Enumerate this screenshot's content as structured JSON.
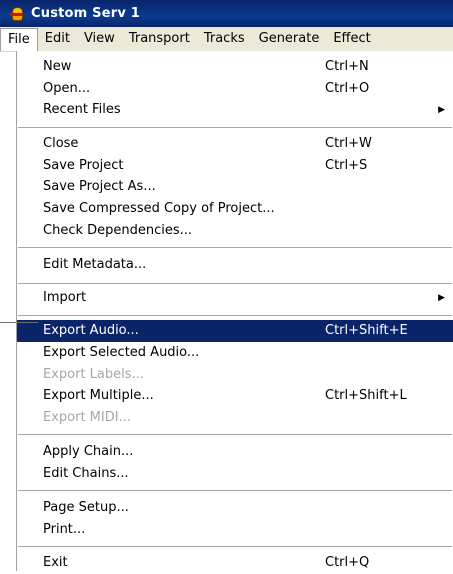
{
  "window": {
    "title": "Custom Serv 1",
    "icon": "audacity-app-icon"
  },
  "menubar": {
    "items": [
      "File",
      "Edit",
      "View",
      "Transport",
      "Tracks",
      "Generate",
      "Effect"
    ]
  },
  "file_menu": {
    "groups": [
      [
        {
          "label": "New",
          "shortcut": "Ctrl+N"
        },
        {
          "label": "Open...",
          "shortcut": "Ctrl+O"
        },
        {
          "label": "Recent Files",
          "submenu": true
        }
      ],
      [
        {
          "label": "Close",
          "shortcut": "Ctrl+W"
        },
        {
          "label": "Save Project",
          "shortcut": "Ctrl+S"
        },
        {
          "label": "Save Project As..."
        },
        {
          "label": "Save Compressed Copy of Project..."
        },
        {
          "label": "Check Dependencies..."
        }
      ],
      [
        {
          "label": "Edit Metadata..."
        }
      ],
      [
        {
          "label": "Import",
          "submenu": true
        }
      ],
      [
        {
          "label": "Export Audio...",
          "shortcut": "Ctrl+Shift+E",
          "highlighted": true
        },
        {
          "label": "Export Selected Audio..."
        },
        {
          "label": "Export Labels...",
          "disabled": true
        },
        {
          "label": "Export Multiple...",
          "shortcut": "Ctrl+Shift+L"
        },
        {
          "label": "Export MIDI...",
          "disabled": true
        }
      ],
      [
        {
          "label": "Apply Chain..."
        },
        {
          "label": "Edit Chains..."
        }
      ],
      [
        {
          "label": "Page Setup..."
        },
        {
          "label": "Print..."
        }
      ],
      [
        {
          "label": "Exit",
          "shortcut": "Ctrl+Q"
        }
      ]
    ]
  },
  "colors": {
    "highlight": "#0a246a",
    "disabled_text": "#a7a6aa",
    "menubar_bg": "#ece9d8"
  }
}
